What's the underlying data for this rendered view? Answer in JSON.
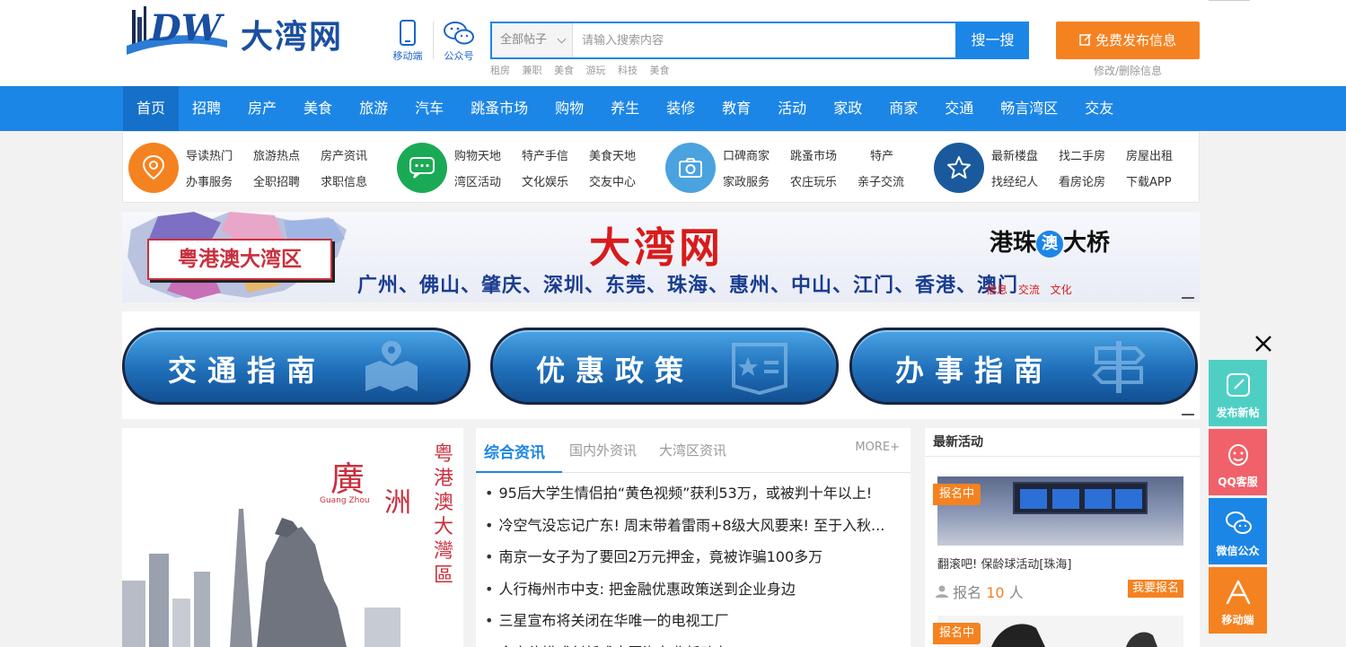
{
  "header": {
    "logo_text": "大湾网",
    "logo_abbr": "DW",
    "mobile_label": "移动端",
    "wechat_label": "公众号",
    "search": {
      "category": "全部帖子",
      "placeholder": "请输入搜索内容",
      "button": "搜一搜",
      "hot_words": [
        "租房",
        "兼职",
        "美食",
        "游玩",
        "科技",
        "美食"
      ]
    },
    "publish_button": "免费发布信息",
    "publish_sub": "修改/删除信息"
  },
  "nav": {
    "items": [
      "首页",
      "招聘",
      "房产",
      "美食",
      "旅游",
      "汽车",
      "跳蚤市场",
      "购物",
      "养生",
      "装修",
      "教育",
      "活动",
      "家政",
      "商家",
      "交通",
      "畅言湾区",
      "交友"
    ]
  },
  "categories": [
    {
      "color": "#f58220",
      "icon": "location-icon",
      "links": [
        "导读热门",
        "旅游热点",
        "房产资讯",
        "办事服务",
        "全职招聘",
        "求职信息"
      ]
    },
    {
      "color": "#1aaa55",
      "icon": "chat-icon",
      "links": [
        "购物天地",
        "特产手信",
        "美食天地",
        "湾区活动",
        "文化娱乐",
        "交友中心"
      ]
    },
    {
      "color": "#4aa3df",
      "icon": "camera-icon",
      "links": [
        "口碑商家",
        "跳蚤市场",
        "特产",
        "家政服务",
        "农庄玩乐",
        "亲子交流"
      ]
    },
    {
      "color": "#1a5a9c",
      "icon": "star-icon",
      "links": [
        "最新楼盘",
        "找二手房",
        "房屋出租",
        "找经纪人",
        "看房论房",
        "下载APP"
      ]
    }
  ],
  "banner1": {
    "tag": "粤港澳大湾区",
    "title": "大湾网",
    "cities": "广州、佛山、肇庆、深圳、东莞、珠海、惠州、中山、江门、香港、澳门",
    "bridge_a": "港珠",
    "bridge_b": "澳",
    "bridge_c": "大桥",
    "sub": "信息 交流 文化"
  },
  "guides": [
    "交通指南",
    "优惠政策",
    "办事指南"
  ],
  "guangzhou": {
    "title_a": "廣",
    "title_b": "洲",
    "en": "Guang Zhou",
    "vertical": "粤港澳大灣區"
  },
  "news": {
    "tabs": [
      "综合资讯",
      "国内外资讯",
      "大湾区资讯"
    ],
    "more": "MORE+",
    "items": [
      "95后大学生情侣拍“黄色视频”获利53万，或被判十年以上!",
      "冷空气没忘记广东! 周末带着雷雨+8级大风要来! 至于入秋...",
      "南京一女子为了要回2万元押金，竟被诈骗100多万",
      "人行梅州市中支: 把金融优惠政策送到企业身边",
      "三星宣布将关闭在华唯一的电视工厂",
      "全方位模式创新成中国汽车业新动力"
    ]
  },
  "activity": {
    "header": "最新活动",
    "badge": "报名中",
    "name": "翻滚吧! 保龄球活动[珠海]",
    "count_label": "报名",
    "count_num": "10",
    "count_unit": "人",
    "join_button": "我要报名",
    "badge2": "报名中"
  },
  "float": {
    "items": [
      {
        "label": "发布新帖",
        "color": "#4fcfc4",
        "icon": "edit-icon"
      },
      {
        "label": "QQ客服",
        "color": "#f0616a",
        "icon": "qq-icon"
      },
      {
        "label": "微信公众",
        "color": "#1c86e6",
        "icon": "wechat-icon"
      },
      {
        "label": "移动端",
        "color": "#f58220",
        "icon": "app-icon"
      }
    ]
  }
}
